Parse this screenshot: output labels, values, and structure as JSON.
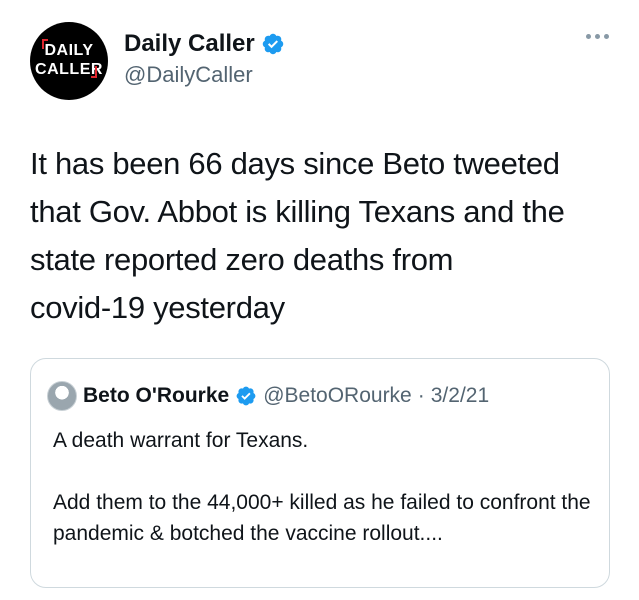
{
  "author": {
    "display_name": "Daily Caller",
    "handle": "@DailyCaller",
    "avatar_logo_line1": "DAILY",
    "avatar_logo_line2": "CALLER",
    "verified": true
  },
  "tweet": {
    "text": "It has been 66 days since Beto tweeted\nthat Gov. Abbot is killing Texans and the\nstate reported zero deaths from\ncovid-19 yesterday"
  },
  "quoted_tweet": {
    "display_name": "Beto O'Rourke",
    "handle": "@BetoORourke",
    "separator": "·",
    "date": "3/2/21",
    "verified": true,
    "paragraph1": "A death warrant for Texans.",
    "paragraph2": "Add them to the 44,000+ killed as he failed to confront the pandemic & botched the vaccine rollout...."
  },
  "colors": {
    "verified_blue": "#1d9bf0",
    "text_primary": "#0f1419",
    "text_secondary": "#536471",
    "logo_red": "#e0262e"
  },
  "icons": {
    "verified": "verified-badge-icon",
    "more": "more-dots-icon"
  }
}
